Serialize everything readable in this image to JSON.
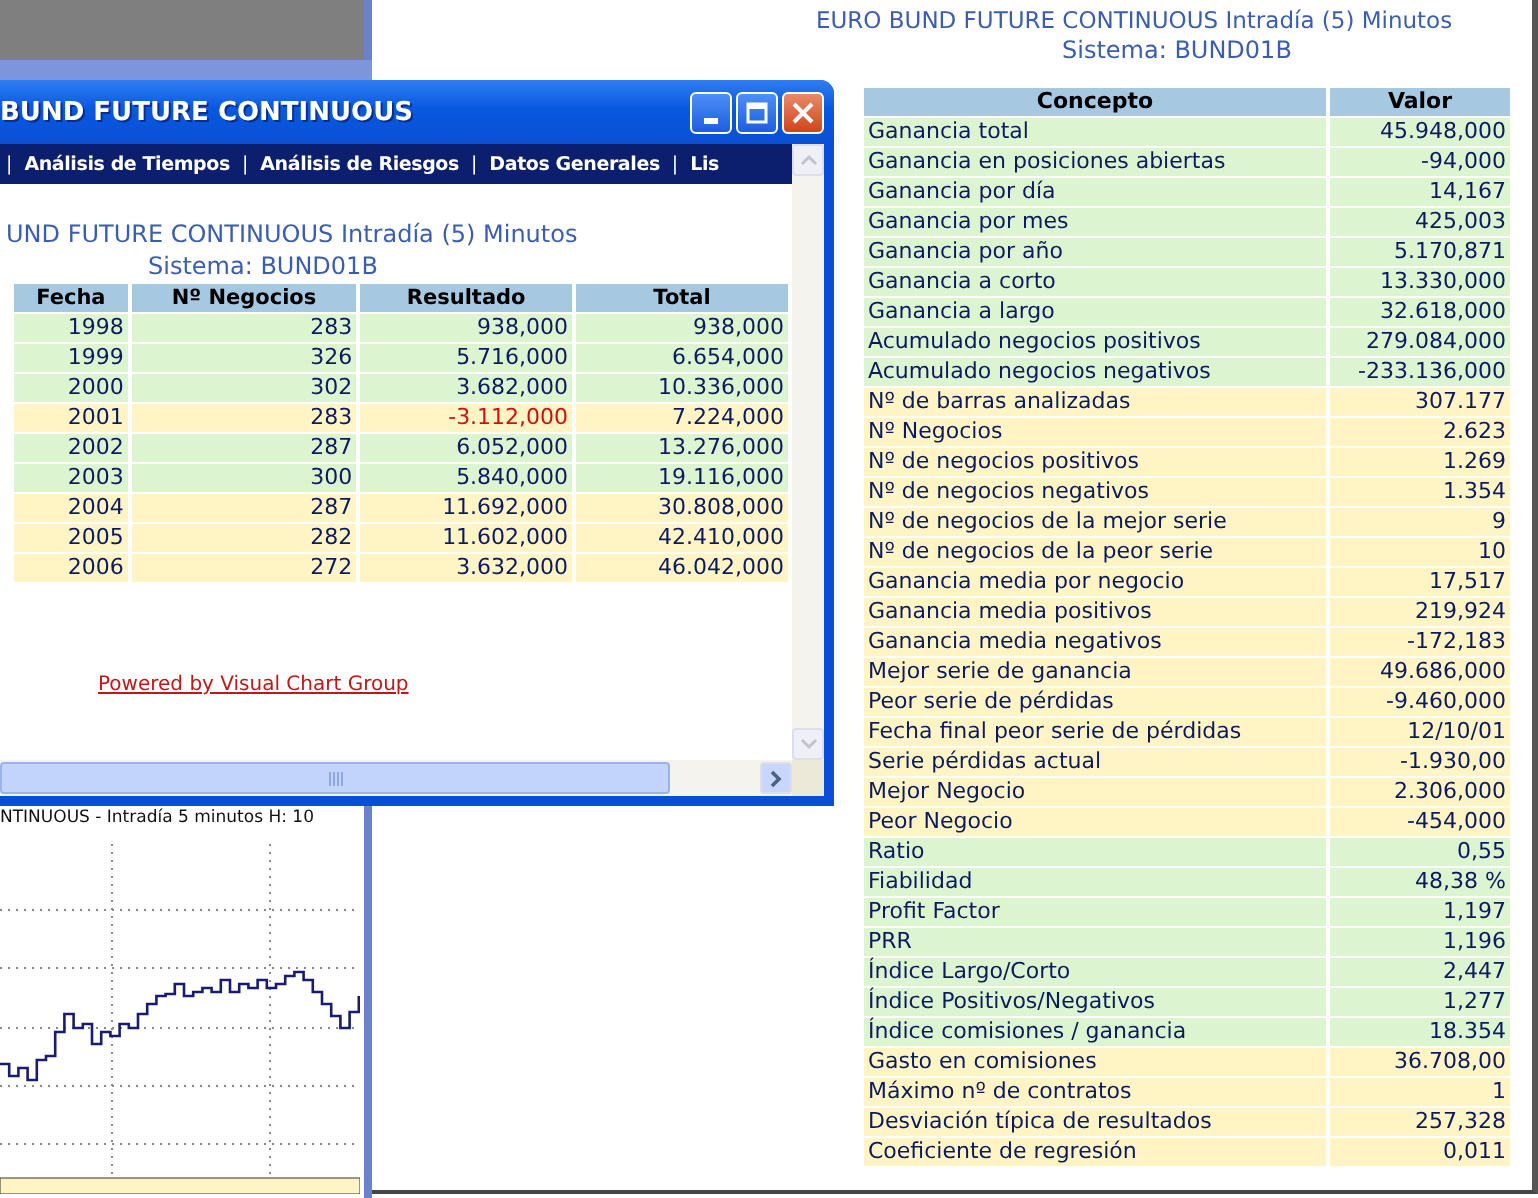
{
  "report": {
    "title": "EURO BUND FUTURE CONTINUOUS Intradía (5) Minutos",
    "subtitle": "Sistema: BUND01B",
    "table": {
      "columns": [
        "Concepto",
        "Valor"
      ],
      "rows": [
        {
          "concepto": "Ganancia total",
          "valor": "45.948,000",
          "color": "#dcf5d0"
        },
        {
          "concepto": "Ganancia en posiciones abiertas",
          "valor": "-94,000",
          "color": "#dcf5d0"
        },
        {
          "concepto": "Ganancia por día",
          "valor": "14,167",
          "color": "#dcf5d0"
        },
        {
          "concepto": "Ganancia por mes",
          "valor": "425,003",
          "color": "#dcf5d0"
        },
        {
          "concepto": "Ganancia por año",
          "valor": "5.170,871",
          "color": "#dcf5d0"
        },
        {
          "concepto": "Ganancia a corto",
          "valor": "13.330,000",
          "color": "#dcf5d0"
        },
        {
          "concepto": "Ganancia a largo",
          "valor": "32.618,000",
          "color": "#dcf5d0"
        },
        {
          "concepto": "Acumulado negocios positivos",
          "valor": "279.084,000",
          "color": "#dcf5d0"
        },
        {
          "concepto": "Acumulado negocios negativos",
          "valor": "-233.136,000",
          "color": "#dcf5d0"
        },
        {
          "concepto": "Nº de barras analizadas",
          "valor": "307.177",
          "color": "#fff5c4"
        },
        {
          "concepto": "Nº Negocios",
          "valor": "2.623",
          "color": "#fff5c4"
        },
        {
          "concepto": "Nº de negocios positivos",
          "valor": "1.269",
          "color": "#fff5c4"
        },
        {
          "concepto": "Nº de negocios negativos",
          "valor": "1.354",
          "color": "#fff5c4"
        },
        {
          "concepto": "Nº de negocios de la mejor serie",
          "valor": "9",
          "color": "#fff5c4"
        },
        {
          "concepto": "Nº de negocios de la peor serie",
          "valor": "10",
          "color": "#fff5c4"
        },
        {
          "concepto": "Ganancia media por negocio",
          "valor": "17,517",
          "color": "#fff5c4"
        },
        {
          "concepto": "Ganancia media positivos",
          "valor": "219,924",
          "color": "#fff5c4"
        },
        {
          "concepto": "Ganancia media negativos",
          "valor": "-172,183",
          "color": "#fff5c4"
        },
        {
          "concepto": "Mejor serie de ganancia",
          "valor": "49.686,000",
          "color": "#fff5c4"
        },
        {
          "concepto": "Peor serie de pérdidas",
          "valor": "-9.460,000",
          "color": "#fff5c4"
        },
        {
          "concepto": "Fecha final peor serie de pérdidas",
          "valor": "12/10/01",
          "color": "#fff5c4"
        },
        {
          "concepto": "Serie pérdidas actual",
          "valor": "-1.930,00",
          "color": "#fff5c4"
        },
        {
          "concepto": "Mejor Negocio",
          "valor": "2.306,000",
          "color": "#fff5c4"
        },
        {
          "concepto": "Peor Negocio",
          "valor": "-454,000",
          "color": "#fff5c4"
        },
        {
          "concepto": "Ratio",
          "valor": "0,55",
          "color": "#dcf5d0"
        },
        {
          "concepto": "Fiabilidad",
          "valor": "48,38 %",
          "color": "#dcf5d0"
        },
        {
          "concepto": "Profit Factor",
          "valor": "1,197",
          "color": "#dcf5d0"
        },
        {
          "concepto": "PRR",
          "valor": "1,196",
          "color": "#dcf5d0"
        },
        {
          "concepto": "Índice Largo/Corto",
          "valor": "2,447",
          "color": "#dcf5d0"
        },
        {
          "concepto": "Índice Positivos/Negativos",
          "valor": "1,277",
          "color": "#dcf5d0"
        },
        {
          "concepto": "Índice comisiones / ganancia",
          "valor": "18.354",
          "color": "#dcf5d0"
        },
        {
          "concepto": "Gasto en comisiones",
          "valor": "36.708,00",
          "color": "#fff5c4"
        },
        {
          "concepto": "Máximo nº de contratos",
          "valor": "1",
          "color": "#fff5c4"
        },
        {
          "concepto": "Desviación típica de resultados",
          "valor": "257,328",
          "color": "#fff5c4"
        },
        {
          "concepto": "Coeficiente de regresión",
          "valor": "0,011",
          "color": "#fff5c4"
        }
      ]
    }
  },
  "chart_panel": {
    "title": "NTINUOUS - Intradía 5 minutos  H: 10"
  },
  "window": {
    "title": "BUND FUTURE CONTINUOUS",
    "menu": [
      {
        "kind": "separator",
        "label": "|"
      },
      {
        "kind": "link",
        "label": "Análisis de Tiempos"
      },
      {
        "kind": "separator",
        "label": "|"
      },
      {
        "kind": "link",
        "label": "Análisis de Riesgos"
      },
      {
        "kind": "separator",
        "label": "|"
      },
      {
        "kind": "link",
        "label": "Datos Generales"
      },
      {
        "kind": "separator",
        "label": "|"
      },
      {
        "kind": "link",
        "label": "Lis"
      }
    ],
    "report_title": "UND FUTURE CONTINUOUS Intradía (5) Minutos",
    "report_subtitle": "Sistema: BUND01B",
    "table": {
      "columns": [
        "Fecha",
        "Nº Negocios",
        "Resultado",
        "Total"
      ],
      "rows": [
        {
          "fecha": "1998",
          "negocios": "283",
          "resultado": "938,000",
          "total": "938,000",
          "color": "#dcf5d0",
          "negative": false
        },
        {
          "fecha": "1999",
          "negocios": "326",
          "resultado": "5.716,000",
          "total": "6.654,000",
          "color": "#dcf5d0",
          "negative": false
        },
        {
          "fecha": "2000",
          "negocios": "302",
          "resultado": "3.682,000",
          "total": "10.336,000",
          "color": "#dcf5d0",
          "negative": false
        },
        {
          "fecha": "2001",
          "negocios": "283",
          "resultado": "-3.112,000",
          "total": "7.224,000",
          "color": "#fff5c4",
          "negative": true
        },
        {
          "fecha": "2002",
          "negocios": "287",
          "resultado": "6.052,000",
          "total": "13.276,000",
          "color": "#dcf5d0",
          "negative": false
        },
        {
          "fecha": "2003",
          "negocios": "300",
          "resultado": "5.840,000",
          "total": "19.116,000",
          "color": "#dcf5d0",
          "negative": false
        },
        {
          "fecha": "2004",
          "negocios": "287",
          "resultado": "11.692,000",
          "total": "30.808,000",
          "color": "#fff5c4",
          "negative": false
        },
        {
          "fecha": "2005",
          "negocios": "282",
          "resultado": "11.602,000",
          "total": "42.410,000",
          "color": "#fff5c4",
          "negative": false
        },
        {
          "fecha": "2006",
          "negocios": "272",
          "resultado": "3.632,000",
          "total": "46.042,000",
          "color": "#fff5c4",
          "negative": false
        }
      ]
    },
    "footer_link": "Powered by Visual Chart Group"
  }
}
